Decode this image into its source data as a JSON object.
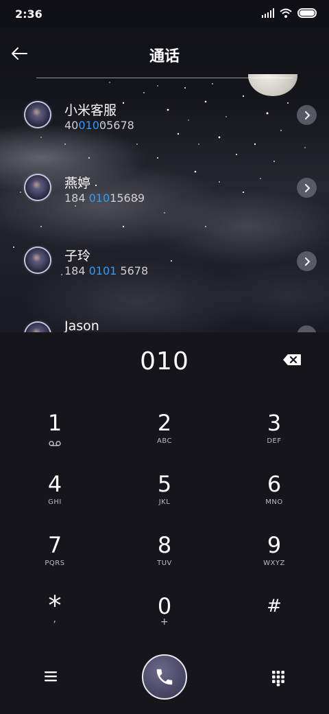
{
  "status_bar": {
    "time": "2:36"
  },
  "header": {
    "title": "通话"
  },
  "contacts": [
    {
      "name": "小米客服",
      "number_pre": "40",
      "number_hl": "010",
      "number_post": "05678"
    },
    {
      "name": "燕婷",
      "number_pre": "184 ",
      "number_hl": "010",
      "number_post": "15689"
    },
    {
      "name": "子玲",
      "number_pre": "184 ",
      "number_hl": "0101",
      "number_post": " 5678"
    },
    {
      "name": "Jason",
      "number_pre": "",
      "number_hl": "",
      "number_post": ""
    }
  ],
  "dialer": {
    "input": "010",
    "keys": [
      {
        "num": "1",
        "sub": "voicemail-icon"
      },
      {
        "num": "2",
        "sub": "ABC"
      },
      {
        "num": "3",
        "sub": "DEF"
      },
      {
        "num": "4",
        "sub": "GHI"
      },
      {
        "num": "5",
        "sub": "JKL"
      },
      {
        "num": "6",
        "sub": "MNO"
      },
      {
        "num": "7",
        "sub": "PQRS"
      },
      {
        "num": "8",
        "sub": "TUV"
      },
      {
        "num": "9",
        "sub": "WXYZ"
      },
      {
        "num": "*",
        "sub": ","
      },
      {
        "num": "0",
        "sub": "+"
      },
      {
        "num": "#",
        "sub": ""
      }
    ]
  },
  "colors": {
    "highlight": "#2f9bff",
    "background": "#16151c"
  }
}
